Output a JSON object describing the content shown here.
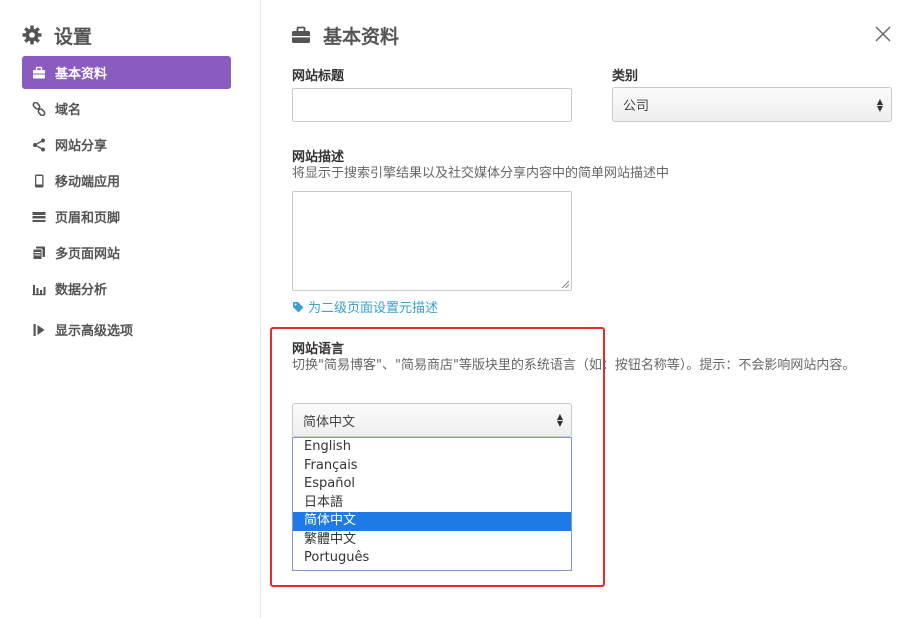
{
  "sidebar": {
    "title": "设置",
    "items": [
      {
        "label": "基本资料",
        "icon": "briefcase-icon",
        "active": true
      },
      {
        "label": "域名",
        "icon": "link-icon"
      },
      {
        "label": "网站分享",
        "icon": "share-icon"
      },
      {
        "label": "移动端应用",
        "icon": "mobile-icon"
      },
      {
        "label": "页眉和页脚",
        "icon": "header-footer-icon"
      },
      {
        "label": "多页面网站",
        "icon": "pages-icon"
      },
      {
        "label": "数据分析",
        "icon": "bar-chart-icon"
      },
      {
        "label": "显示高级选项",
        "icon": "advanced-icon"
      }
    ]
  },
  "main": {
    "title": "基本资料",
    "site_title": {
      "label": "网站标题",
      "value": ""
    },
    "category": {
      "label": "类别",
      "value": "公司"
    },
    "site_desc": {
      "label": "网站描述",
      "help": "将显示于搜索引擎结果以及社交媒体分享内容中的简单网站描述中",
      "value": ""
    },
    "meta_link": "为二级页面设置元描述",
    "language": {
      "label": "网站语言",
      "help": "切换\"简易博客\"、\"简易商店\"等版块里的系统语言（如：按钮名称等）。提示：不会影响网站内容。",
      "value": "简体中文",
      "options": [
        "English",
        "Français",
        "Español",
        "日本語",
        "简体中文",
        "繁體中文",
        "Português"
      ],
      "selected_index": 4
    }
  },
  "colors": {
    "accent": "#8a5cbf",
    "highlight": "#e52b2b",
    "selection": "#1e7be6",
    "link": "#3aa0cc"
  }
}
